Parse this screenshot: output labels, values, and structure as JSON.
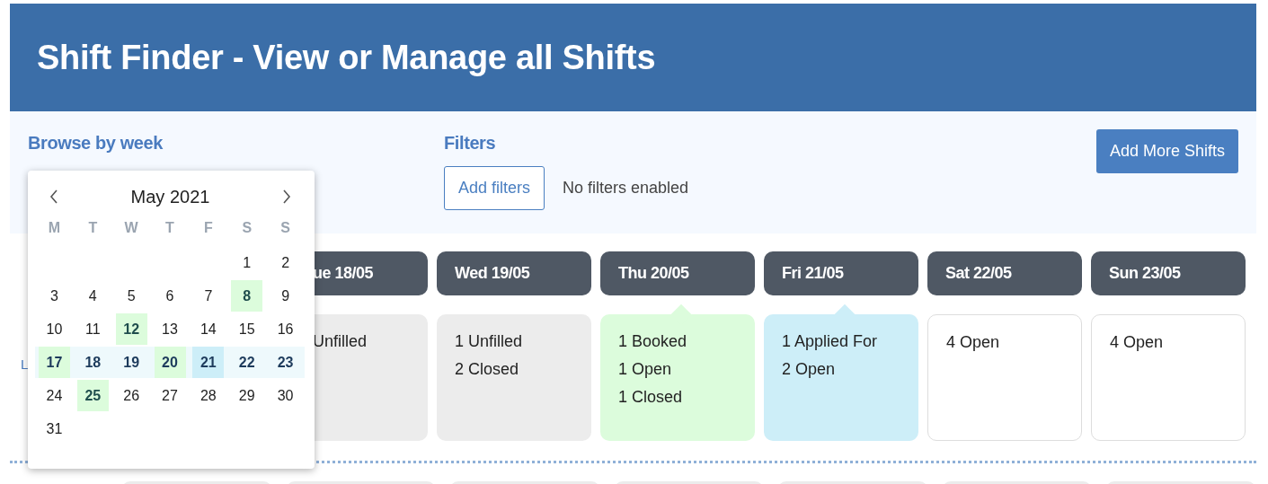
{
  "header": {
    "title": "Shift Finder - View or Manage all Shifts"
  },
  "browse": {
    "label": "Browse by week"
  },
  "filters": {
    "label": "Filters",
    "button": "Add filters",
    "status": "No filters enabled"
  },
  "add_button": "Add More Shifts",
  "row_label": "L",
  "calendar": {
    "month": "May 2021",
    "weekdays": [
      "M",
      "T",
      "W",
      "T",
      "F",
      "S",
      "S"
    ],
    "weeks": [
      {
        "selected": false,
        "days": [
          {
            "day": "1"
          },
          {
            "day": "2"
          }
        ]
      },
      {
        "selected": false,
        "days": [
          {
            "day": "3"
          },
          {
            "day": "4"
          },
          {
            "day": "5"
          },
          {
            "day": "6"
          },
          {
            "day": "7"
          },
          {
            "day": "8",
            "color": "#dcfcdc"
          },
          {
            "day": "9"
          }
        ]
      },
      {
        "selected": false,
        "days": [
          {
            "day": "10"
          },
          {
            "day": "11"
          },
          {
            "day": "12",
            "color": "#dcfcdc"
          },
          {
            "day": "13"
          },
          {
            "day": "14"
          },
          {
            "day": "15"
          },
          {
            "day": "16"
          }
        ]
      },
      {
        "selected": true,
        "days": [
          {
            "day": "17",
            "color": "#dcfcdc"
          },
          {
            "day": "18"
          },
          {
            "day": "19"
          },
          {
            "day": "20",
            "color": "#dcfcdc"
          },
          {
            "day": "21",
            "color": "#cdeef8"
          },
          {
            "day": "22"
          },
          {
            "day": "23"
          }
        ]
      },
      {
        "selected": false,
        "days": [
          {
            "day": "24"
          },
          {
            "day": "25",
            "color": "#dcfcdc"
          },
          {
            "day": "26"
          },
          {
            "day": "27"
          },
          {
            "day": "28"
          },
          {
            "day": "29"
          },
          {
            "day": "30"
          }
        ]
      },
      {
        "selected": false,
        "days": [
          {
            "day": "31"
          }
        ]
      }
    ]
  },
  "days": [
    {
      "header": "ue 18/05",
      "partial": true,
      "color": "#ececec",
      "pointer": false,
      "lines": [
        "Unfilled"
      ]
    },
    {
      "header": "Wed 19/05",
      "partial": false,
      "color": "#ececec",
      "pointer": false,
      "lines": [
        "1 Unfilled",
        "2 Closed"
      ]
    },
    {
      "header": "Thu 20/05",
      "partial": false,
      "color": "#dcfcdc",
      "pointer": true,
      "lines": [
        "1 Booked",
        "1 Open",
        "1 Closed"
      ]
    },
    {
      "header": "Fri 21/05",
      "partial": false,
      "color": "#cdeef8",
      "pointer": true,
      "lines": [
        "1 Applied For",
        "2 Open"
      ]
    },
    {
      "header": "Sat 22/05",
      "partial": false,
      "color": "#ffffff",
      "pointer": false,
      "lines": [
        "4 Open"
      ]
    },
    {
      "header": "Sun 23/05",
      "partial": false,
      "color": "#ffffff",
      "pointer": false,
      "lines": [
        "4 Open"
      ]
    }
  ]
}
